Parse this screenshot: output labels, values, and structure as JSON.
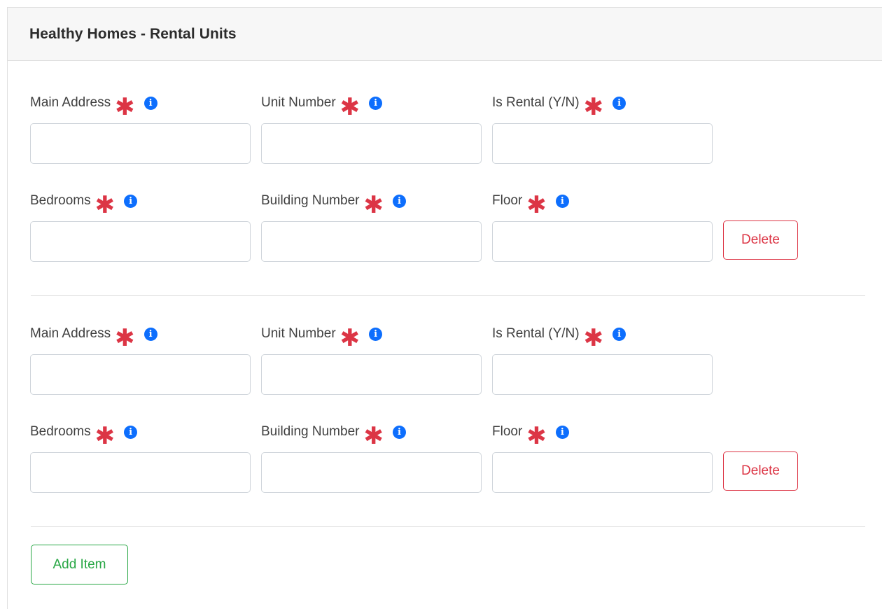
{
  "card": {
    "title": "Healthy Homes - Rental Units"
  },
  "fields": {
    "main_address": "Main Address",
    "unit_number": "Unit Number",
    "is_rental": "Is Rental (Y/N)",
    "bedrooms": "Bedrooms",
    "building_number": "Building Number",
    "floor": "Floor"
  },
  "required_mark": "✱",
  "info_mark": "i",
  "buttons": {
    "delete": "Delete",
    "add_item": "Add Item"
  },
  "colors": {
    "required": "#dc3545",
    "info": "#0d6efd",
    "delete": "#dc3545",
    "add": "#28a745"
  },
  "items": [
    {
      "main_address": "",
      "unit_number": "",
      "is_rental": "",
      "bedrooms": "",
      "building_number": "",
      "floor": ""
    },
    {
      "main_address": "",
      "unit_number": "",
      "is_rental": "",
      "bedrooms": "",
      "building_number": "",
      "floor": ""
    }
  ]
}
